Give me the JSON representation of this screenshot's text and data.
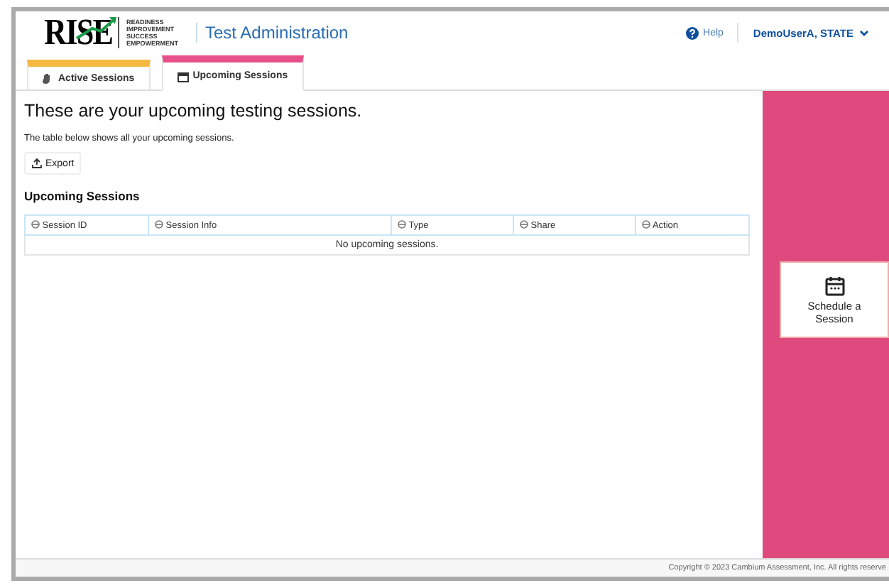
{
  "header": {
    "logo": {
      "wordmark": "RISE",
      "tagline": [
        "READINESS",
        "IMPROVEMENT",
        "SUCCESS",
        "EMPOWERMENT"
      ]
    },
    "title": "Test Administration",
    "help": "Help",
    "user": "DemoUserA, STATE"
  },
  "tabs": [
    {
      "label": "Active Sessions",
      "color": "#f5b841",
      "selected": false
    },
    {
      "label": "Upcoming Sessions",
      "color": "#e8508a",
      "selected": true
    }
  ],
  "main": {
    "heading": "These are your upcoming testing sessions.",
    "description": "The table below shows all your upcoming sessions.",
    "export_button": "Export",
    "section_title": "Upcoming Sessions",
    "table": {
      "columns": [
        "Session ID",
        "Session Info",
        "Type",
        "Share",
        "Action"
      ],
      "empty_message": "No upcoming sessions."
    }
  },
  "side_panel": {
    "button": "Schedule a Session"
  },
  "footer": "Copyright © 2023 Cambium Assessment, Inc. All rights reserve"
}
